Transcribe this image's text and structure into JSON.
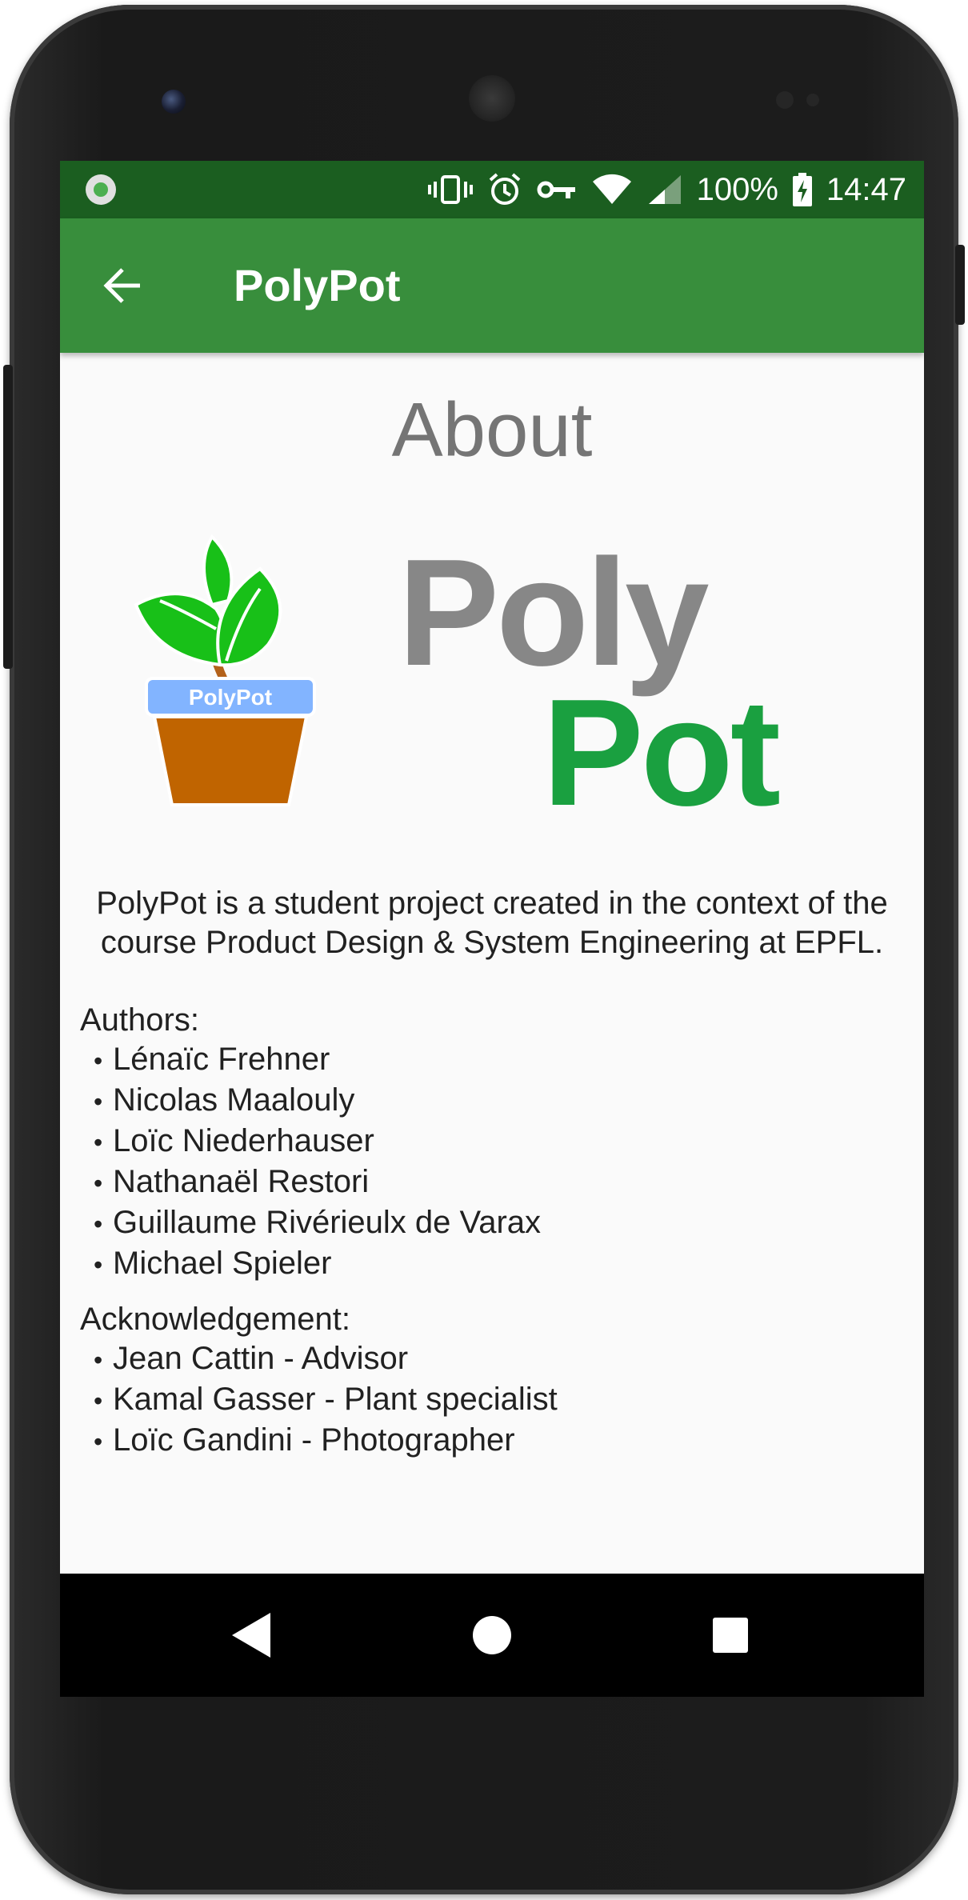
{
  "status_bar": {
    "battery_percent": "100%",
    "time": "14:47",
    "icons": [
      "app-notification-icon",
      "vibrate-icon",
      "alarm-icon",
      "vpn-key-icon",
      "wifi-icon",
      "cell-signal-icon",
      "battery-charging-icon"
    ]
  },
  "app_bar": {
    "title": "PolyPot",
    "back_icon": "arrow-back-icon"
  },
  "content": {
    "heading": "About",
    "logo": {
      "word1": "Poly",
      "word2": "Pot",
      "pot_label": "PolyPot",
      "colors": {
        "poly_grey": "#878787",
        "pot_green": "#1aa040",
        "leaves": "#18c018",
        "pot_body": "#c06400",
        "pot_band": "#82b4ff"
      }
    },
    "description": "PolyPot is a student project created in the context of the course Product Design & System Engineering at EPFL.",
    "authors_label": "Authors:",
    "authors": [
      "Lénaïc Frehner",
      "Nicolas Maalouly",
      "Loïc Niederhauser",
      "Nathanaël Restori",
      "Guillaume Rivérieulx de Varax",
      "Michael Spieler"
    ],
    "ack_label": "Acknowledgement:",
    "acknowledgements": [
      "Jean Cattin - Advisor",
      "Kamal Gasser - Plant specialist",
      "Loïc Gandini - Photographer"
    ]
  },
  "nav_bar": {
    "icons": [
      "back-triangle-icon",
      "home-circle-icon",
      "recents-square-icon"
    ]
  },
  "colors": {
    "status_bar": "#1b5e20",
    "app_bar": "#388e3c",
    "background": "#fafafa",
    "heading_text": "#757575",
    "body_text": "#212121"
  }
}
